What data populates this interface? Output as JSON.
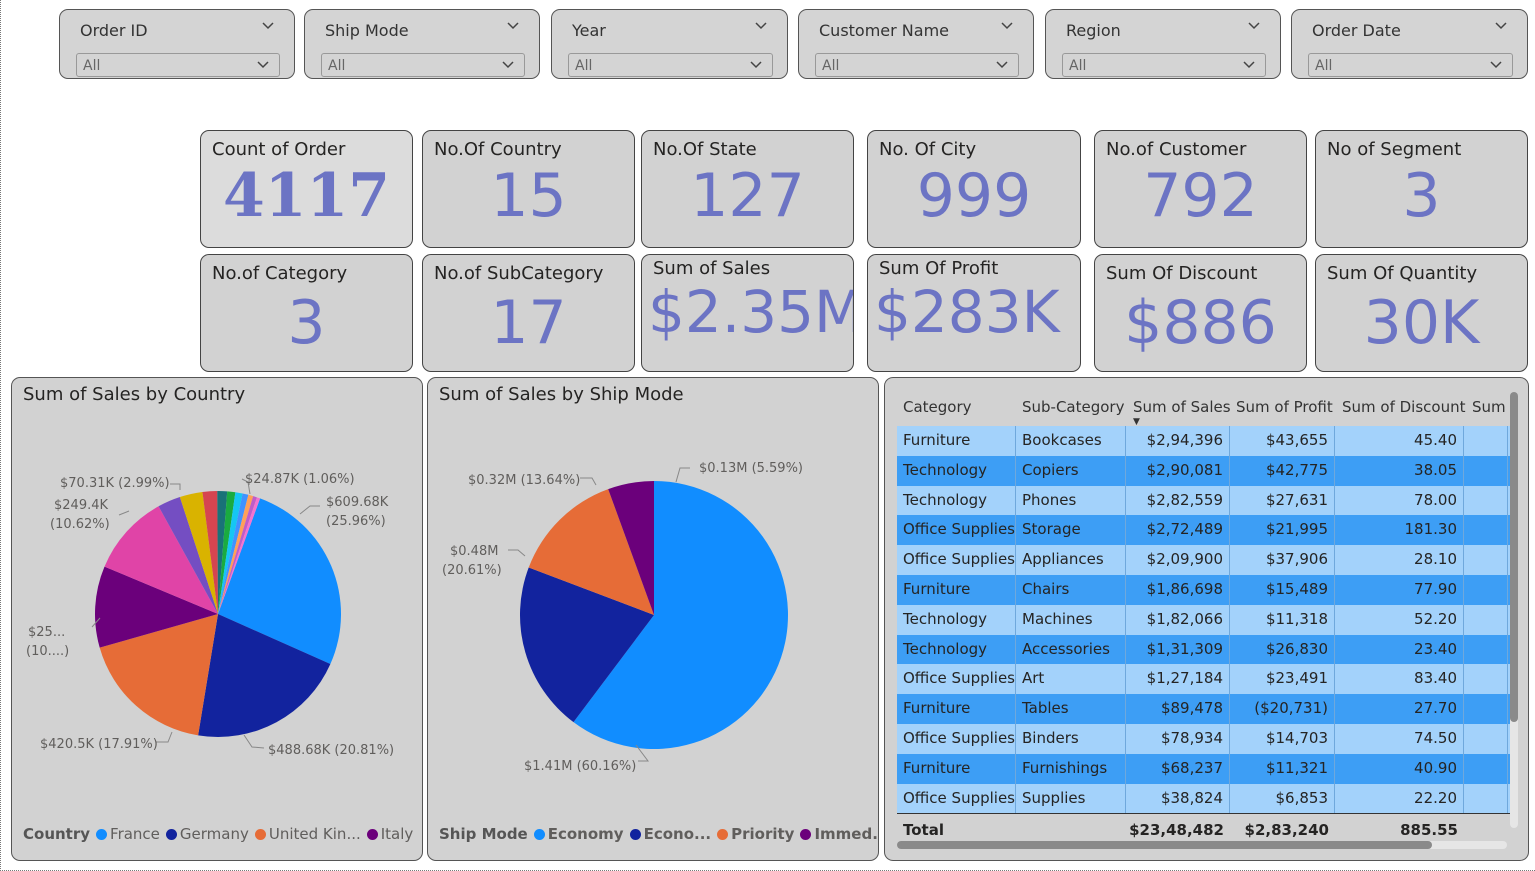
{
  "slicers": [
    {
      "title": "Order ID",
      "value": "All"
    },
    {
      "title": "Ship Mode",
      "value": "All"
    },
    {
      "title": "Year",
      "value": "All"
    },
    {
      "title": "Customer Name",
      "value": "All"
    },
    {
      "title": "Region",
      "value": "All"
    },
    {
      "title": "Order Date",
      "value": "All"
    }
  ],
  "cards": [
    {
      "title": "Count of Order",
      "value": "4117"
    },
    {
      "title": "No.Of Country",
      "value": "15"
    },
    {
      "title": "No.Of State",
      "value": "127"
    },
    {
      "title": "No. Of City",
      "value": "999"
    },
    {
      "title": "No.of Customer",
      "value": "792"
    },
    {
      "title": "No of Segment",
      "value": "3"
    },
    {
      "title": "No.of Category",
      "value": "3"
    },
    {
      "title": "No.of SubCategory",
      "value": "17"
    },
    {
      "title": "Sum of Sales",
      "value": "$2.35M"
    },
    {
      "title": "Sum Of Profit",
      "value": "$283K"
    },
    {
      "title": "Sum Of Discount",
      "value": "$886"
    },
    {
      "title": "Sum Of Quantity",
      "value": "30K"
    }
  ],
  "country_chart": {
    "title": "Sum of Sales by Country",
    "legend_title": "Country",
    "legend": [
      {
        "name": "France",
        "color": "#118dff"
      },
      {
        "name": "Germany",
        "color": "#12239e"
      },
      {
        "name": "United Kin...",
        "color": "#e66c37"
      },
      {
        "name": "Italy",
        "color": "#6b007b"
      }
    ],
    "labels": {
      "france": "$609.68K",
      "france_pct": "(25.96%)",
      "germany": "$488.68K (20.81%)",
      "uk": "$420.5K (17.91%)",
      "italy": "$25...",
      "italy_pct": "(10....)",
      "s5": "$249.4K",
      "s5_pct": "(10.62%)",
      "s6": "$70.31K (2.99%)",
      "s7": "$24.87K (1.06%)"
    }
  },
  "shipmode_chart": {
    "title": "Sum of Sales by Ship Mode",
    "legend_title": "Ship Mode",
    "legend": [
      {
        "name": "Economy",
        "color": "#118dff"
      },
      {
        "name": "Econo...",
        "color": "#12239e"
      },
      {
        "name": "Priority",
        "color": "#e66c37"
      },
      {
        "name": "Immed...",
        "color": "#6b007b"
      }
    ],
    "labels": {
      "economy": "$1.41M (60.16%)",
      "econo2": "$0.48M",
      "econo2_pct": "(20.61%)",
      "priority": "$0.32M (13.64%)",
      "immed": "$0.13M (5.59%)"
    }
  },
  "chart_data": [
    {
      "type": "pie",
      "title": "Sum of Sales by Country",
      "categories": [
        "France",
        "Germany",
        "United Kin...",
        "Italy",
        "",
        "",
        "",
        "",
        "",
        "",
        "",
        "",
        "",
        "",
        ""
      ],
      "values": [
        609.68,
        488.68,
        420.5,
        250,
        249.4,
        70.31,
        70,
        45,
        30,
        24.87,
        22,
        18,
        15,
        12,
        10
      ],
      "unit": "$K",
      "colors": [
        "#118dff",
        "#12239e",
        "#e66c37",
        "#6b007b",
        "#e044a7",
        "#744ec2",
        "#d9b300",
        "#d64550",
        "#197278",
        "#1aab40",
        "#15c6f4",
        "#4092ff",
        "#ffa058",
        "#be5dc9",
        "#f472d0"
      ]
    },
    {
      "type": "pie",
      "title": "Sum of Sales by Ship Mode",
      "categories": [
        "Economy",
        "Econo...",
        "Priority",
        "Immed..."
      ],
      "values": [
        1.41,
        0.48,
        0.32,
        0.13
      ],
      "unit": "$M",
      "colors": [
        "#118dff",
        "#12239e",
        "#e66c37",
        "#6b007b"
      ]
    }
  ],
  "table": {
    "headers": [
      "Category",
      "Sub-Category",
      "Sum of Sales",
      "Sum of Profit",
      "Sum of Discount",
      "Sum"
    ],
    "rows": [
      [
        "Furniture",
        "Bookcases",
        "$2,94,396",
        "$43,655",
        "45.40"
      ],
      [
        "Technology",
        "Copiers",
        "$2,90,081",
        "$42,775",
        "38.05"
      ],
      [
        "Technology",
        "Phones",
        "$2,82,559",
        "$27,631",
        "78.00"
      ],
      [
        "Office Supplies",
        "Storage",
        "$2,72,489",
        "$21,995",
        "181.30"
      ],
      [
        "Office Supplies",
        "Appliances",
        "$2,09,900",
        "$37,906",
        "28.10"
      ],
      [
        "Furniture",
        "Chairs",
        "$1,86,698",
        "$15,489",
        "77.90"
      ],
      [
        "Technology",
        "Machines",
        "$1,82,066",
        "$11,318",
        "52.20"
      ],
      [
        "Technology",
        "Accessories",
        "$1,31,309",
        "$26,830",
        "23.40"
      ],
      [
        "Office Supplies",
        "Art",
        "$1,27,184",
        "$23,491",
        "83.40"
      ],
      [
        "Furniture",
        "Tables",
        "$89,478",
        "($20,731)",
        "27.70"
      ],
      [
        "Office Supplies",
        "Binders",
        "$78,934",
        "$14,703",
        "74.50"
      ],
      [
        "Furniture",
        "Furnishings",
        "$68,237",
        "$11,321",
        "40.90"
      ],
      [
        "Office Supplies",
        "Supplies",
        "$38,824",
        "$6,853",
        "22.20"
      ]
    ],
    "total": {
      "label": "Total",
      "sales": "$23,48,482",
      "profit": "$2,83,240",
      "discount": "885.55"
    }
  }
}
